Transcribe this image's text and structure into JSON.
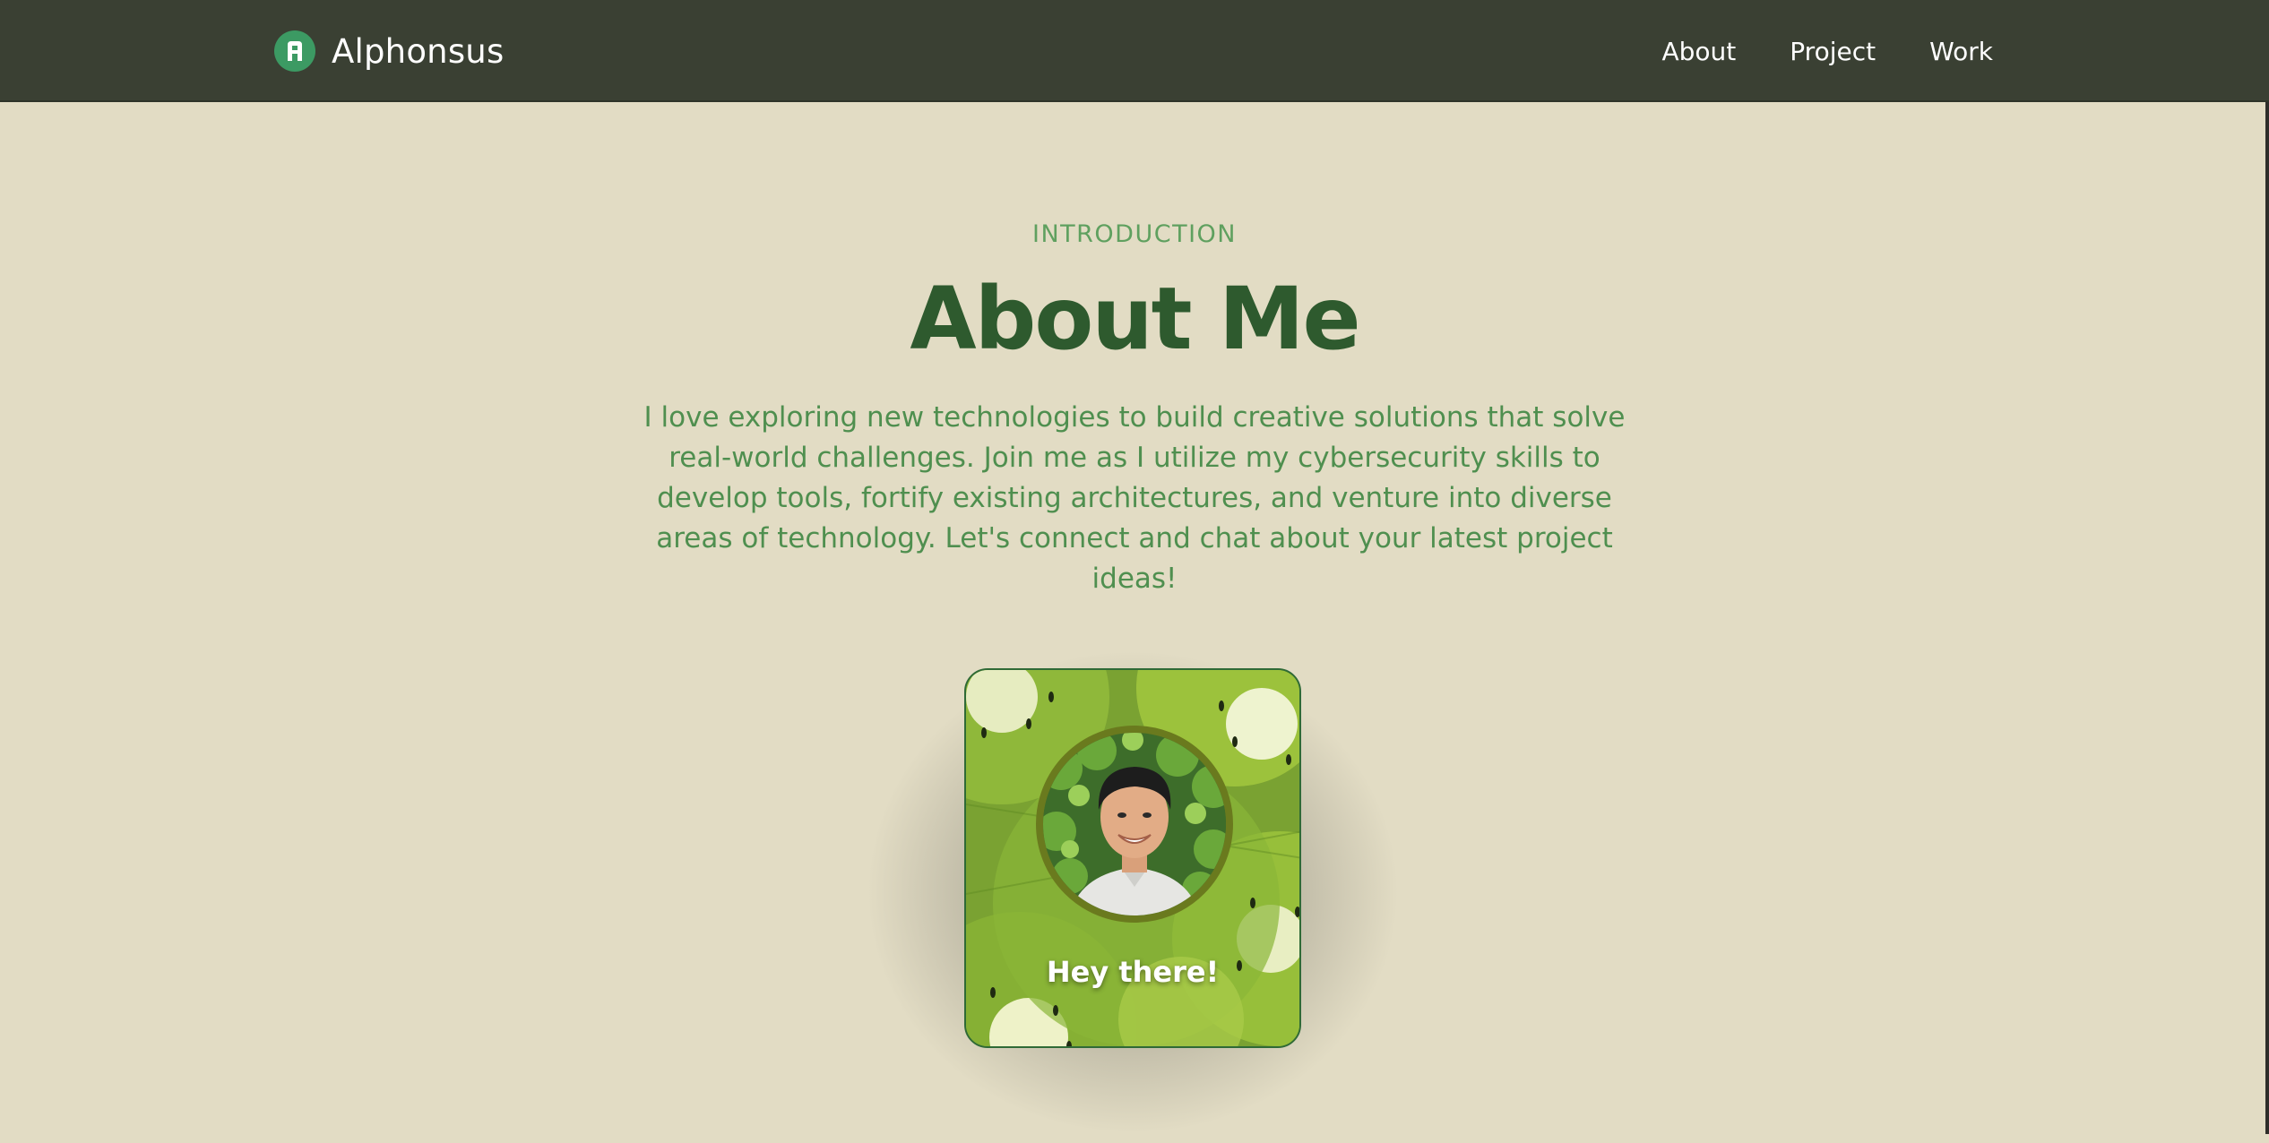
{
  "header": {
    "brand_name": "Alphonsus",
    "logo_icon": "letter-a-logo-icon",
    "nav": [
      {
        "label": "About"
      },
      {
        "label": "Project"
      },
      {
        "label": "Work"
      }
    ]
  },
  "hero": {
    "eyebrow": "INTRODUCTION",
    "title": "About Me",
    "description": "I love exploring new technologies to build creative solutions that solve real-world challenges. Join me as I utilize my cybersecurity skills to develop tools, fortify existing architectures, and venture into diverse areas of technology. Let's connect and chat about your latest project ideas!"
  },
  "card": {
    "greeting": "Hey there!"
  },
  "colors": {
    "navbar": "#3a4033",
    "page_background": "#e2dcc4",
    "accent_green": "#5fa05f",
    "title_green": "#2e5a2e"
  }
}
